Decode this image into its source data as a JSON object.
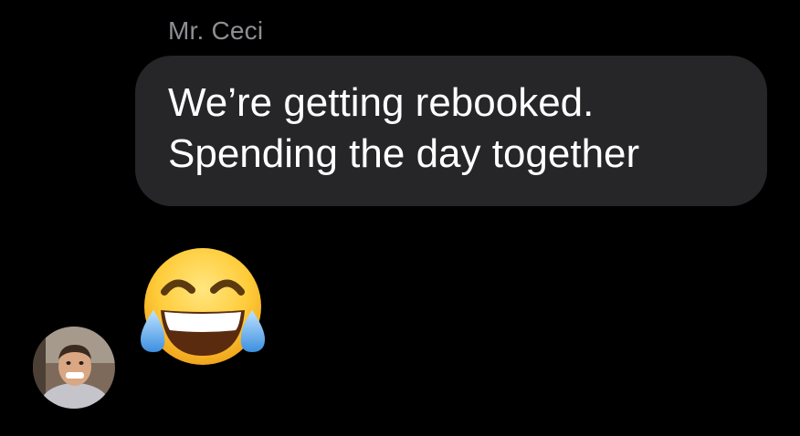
{
  "conversation": {
    "sender_name": "Mr. Ceci",
    "messages": [
      {
        "type": "text",
        "lines": [
          "We’re getting rebooked.",
          "Spending the day together"
        ]
      },
      {
        "type": "emoji",
        "icon": "face-with-tears-of-joy-icon"
      }
    ]
  },
  "contact": {
    "avatar_icon": "contact-avatar-photo"
  },
  "colors": {
    "background": "#000000",
    "bubble": "#262628",
    "sender_name": "#8e8e93",
    "message_text": "#ffffff"
  }
}
